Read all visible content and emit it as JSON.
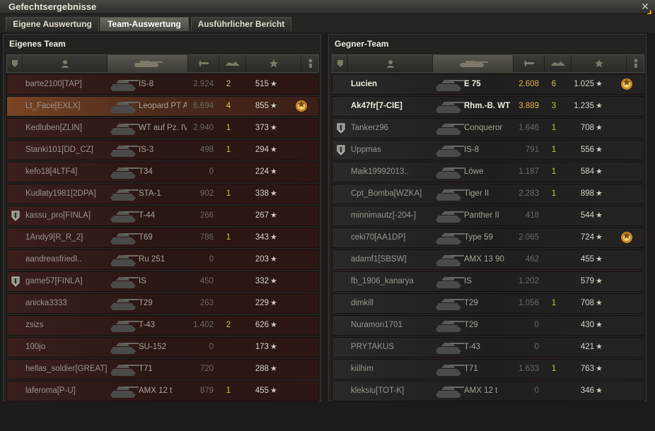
{
  "window": {
    "title": "Gefechtsergebnisse",
    "close_icon": "close-icon"
  },
  "tabs": [
    {
      "label": "Eigene Auswertung",
      "active": false
    },
    {
      "label": "Team-Auswertung",
      "active": true
    },
    {
      "label": "Ausführlicher Bericht",
      "active": false
    }
  ],
  "own_team": {
    "title": "Eigenes Team",
    "rows": [
      {
        "name": "barte2100[TAP]",
        "tank": "IS-8",
        "damage": "2.924",
        "kills": "2",
        "xp": "515"
      },
      {
        "name": "Lt_Face[EXLX]",
        "tank": "Leopard PT A",
        "damage": "6.694",
        "kills": "4",
        "xp": "855",
        "highlight": true,
        "medal": "2"
      },
      {
        "name": "Kedluben[ZLIN]",
        "tank": "WT auf Pz. IV",
        "damage": "2.940",
        "kills": "1",
        "xp": "373"
      },
      {
        "name": "Stanki101[DD_CZ]",
        "tank": "IS-3",
        "damage": "498",
        "kills": "1",
        "xp": "294"
      },
      {
        "name": "kefo18[4LTF4]",
        "tank": "T34",
        "damage": "0",
        "kills": "",
        "xp": "224"
      },
      {
        "name": "Kudlaty1981[2DPA]",
        "tank": "STA-1",
        "damage": "902",
        "kills": "1",
        "xp": "338"
      },
      {
        "name": "kassu_pro[FINLA]",
        "tank": "T-44",
        "damage": "266",
        "kills": "",
        "xp": "267",
        "clan_icon": true
      },
      {
        "name": "1Andy9[R_R_2]",
        "tank": "T69",
        "damage": "786",
        "kills": "1",
        "xp": "343"
      },
      {
        "name": "aandreasfriedl..",
        "tank": "Ru 251",
        "damage": "0",
        "kills": "",
        "xp": "203"
      },
      {
        "name": "game57[FINLA]",
        "tank": "IS",
        "damage": "450",
        "kills": "",
        "xp": "332",
        "clan_icon": true
      },
      {
        "name": "anicka3333",
        "tank": "T29",
        "damage": "263",
        "kills": "",
        "xp": "229"
      },
      {
        "name": "zsizs",
        "tank": "T-43",
        "damage": "1.402",
        "kills": "2",
        "xp": "626"
      },
      {
        "name": "100jo",
        "tank": "SU-152",
        "damage": "0",
        "kills": "",
        "xp": "173"
      },
      {
        "name": "hellas_soldier[GREAT]",
        "tank": "T71",
        "damage": "720",
        "kills": "",
        "xp": "288"
      },
      {
        "name": "laferoma[P-U]",
        "tank": "AMX 12 t",
        "damage": "879",
        "kills": "1",
        "xp": "455"
      }
    ]
  },
  "enemy_team": {
    "title": "Gegner-Team",
    "rows": [
      {
        "name": "Lucien",
        "tank": "E 75",
        "damage": "2.608",
        "kills": "6",
        "xp": "1.025",
        "bold": true,
        "medal": "3"
      },
      {
        "name": "Ak47fr[7-CIE]",
        "tank": "Rhm.-B. WT",
        "damage": "3.889",
        "kills": "3",
        "xp": "1.235",
        "bold": true
      },
      {
        "name": "Tankerz96",
        "tank": "Conqueror",
        "damage": "1.646",
        "kills": "1",
        "xp": "708",
        "clan_icon": true
      },
      {
        "name": "Uppmas",
        "tank": "IS-8",
        "damage": "791",
        "kills": "1",
        "xp": "556",
        "clan_icon": true
      },
      {
        "name": "Maik19992013..",
        "tank": "Löwe",
        "damage": "1.187",
        "kills": "1",
        "xp": "584"
      },
      {
        "name": "Cpt_Bomba[WZKA]",
        "tank": "Tiger II",
        "damage": "2.283",
        "kills": "1",
        "xp": "898"
      },
      {
        "name": "minnimautz[-204-]",
        "tank": "Panther II",
        "damage": "418",
        "kills": "",
        "xp": "544"
      },
      {
        "name": "ceki70[AA1DP]",
        "tank": "Type 59",
        "damage": "2.065",
        "kills": "",
        "xp": "724",
        "medal": ""
      },
      {
        "name": "adamf1[SBSW]",
        "tank": "AMX 13 90",
        "damage": "462",
        "kills": "",
        "xp": "455"
      },
      {
        "name": "fb_1906_kanarya",
        "tank": "IS",
        "damage": "1.202",
        "kills": "",
        "xp": "579"
      },
      {
        "name": "dimkill",
        "tank": "T29",
        "damage": "1.056",
        "kills": "1",
        "xp": "708"
      },
      {
        "name": "Nuramon1701",
        "tank": "T29",
        "damage": "0",
        "kills": "",
        "xp": "430"
      },
      {
        "name": "PRYTAKUS",
        "tank": "T-43",
        "damage": "0",
        "kills": "",
        "xp": "421"
      },
      {
        "name": "kiilhim",
        "tank": "T71",
        "damage": "1.633",
        "kills": "1",
        "xp": "763"
      },
      {
        "name": "kleksiu[TOT-K]",
        "tank": "AMX 12 t",
        "damage": "0",
        "kills": "",
        "xp": "346"
      }
    ]
  },
  "columns": [
    {
      "icon": "squad-icon"
    },
    {
      "icon": "player-icon"
    },
    {
      "icon": "tank-icon",
      "sorted": true
    },
    {
      "icon": "damage-icon"
    },
    {
      "icon": "kills-icon"
    },
    {
      "icon": "xp-star-icon"
    },
    {
      "icon": "medal-icon"
    }
  ],
  "colors": {
    "own_row": "#3a1f1c",
    "enemy_row": "#2a2928",
    "kills": "#d8c24a"
  }
}
